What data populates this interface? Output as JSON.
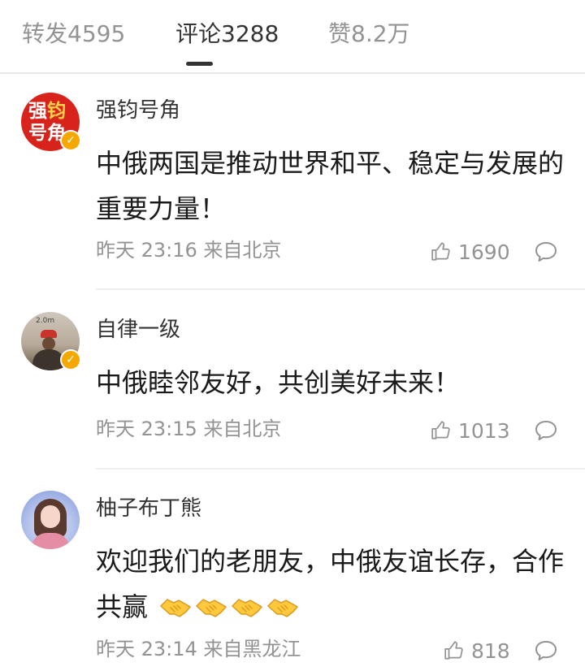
{
  "tabs": [
    {
      "label": "转发4595",
      "active": false
    },
    {
      "label": "评论3288",
      "active": true
    },
    {
      "label": "赞8.2万",
      "active": false
    }
  ],
  "colors": {
    "text_primary": "#1a1a1a",
    "text_secondary": "#939393",
    "verified_badge": "#f5a800",
    "brand_red": "#d8231d"
  },
  "comments": [
    {
      "username": "强钧号角",
      "avatar_text": [
        "强",
        "钧",
        "号",
        "角"
      ],
      "verified": true,
      "text": "中俄两国是推动世界和平、稳定与发展的重要力量！",
      "time_location": "昨天 23:16 来自北京",
      "likes": "1690"
    },
    {
      "username": "自律一级",
      "avatar_sign": "2.0m",
      "verified": true,
      "text": "中俄睦邻友好，共创美好未来！",
      "time_location": "昨天 23:15 来自北京",
      "likes": "1013"
    },
    {
      "username": "柚子布丁熊",
      "verified": false,
      "text": "欢迎我们的老朋友，中俄友谊长存，合作共赢",
      "emojis": [
        "handshake-emoji",
        "handshake-emoji",
        "handshake-emoji",
        "handshake-emoji"
      ],
      "time_location": "昨天 23:14 来自黑龙江",
      "likes": "818"
    }
  ]
}
